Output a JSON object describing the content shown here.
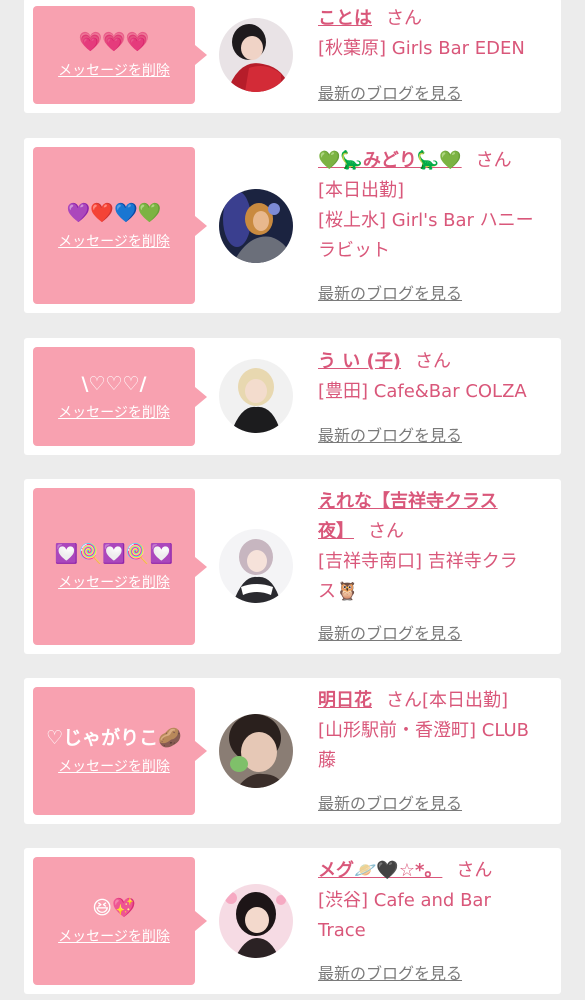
{
  "labels": {
    "delete_message": "メッセージを削除",
    "latest_blog": "最新のブログを見る",
    "honorific": "さん"
  },
  "entries": [
    {
      "message": "💗💗💗",
      "name": "ことは",
      "shop_lines": [
        "[秋葉原] Girls Bar EDEN"
      ]
    },
    {
      "message": "💜❤️💙💚",
      "name": "💚🦕みどり🦕💚",
      "shop_lines": [
        "[本日出勤]",
        "[桜上水] Girl's Bar ハニー",
        "ラビット"
      ]
    },
    {
      "message": "\\♡♡♡/",
      "name": "う い (子)",
      "shop_lines": [
        "[豊田] Cafe&Bar COLZA"
      ]
    },
    {
      "message": "💟🍭💟🍭💟",
      "name_lines": [
        "えれな【吉祥寺クラス",
        "夜】"
      ],
      "shop_lines": [
        "[吉祥寺南口] 吉祥寺クラ",
        "ス🦉"
      ]
    },
    {
      "message": "♡じゃがりこ🥔",
      "name": "明日花",
      "name_suffix": "[本日出勤]",
      "shop_lines": [
        "[山形駅前・香澄町] CLUB",
        "藤"
      ]
    },
    {
      "message": "😆💖",
      "name": "メグ🪐🖤☆*。",
      "shop_lines": [
        "[渋谷] Cafe and Bar",
        "Trace"
      ]
    }
  ],
  "colors": {
    "background": "#ececec",
    "card": "#ffffff",
    "message_box": "#f8a1b0",
    "accent_text": "#d9577a",
    "link_gray": "#7a7a7a"
  }
}
